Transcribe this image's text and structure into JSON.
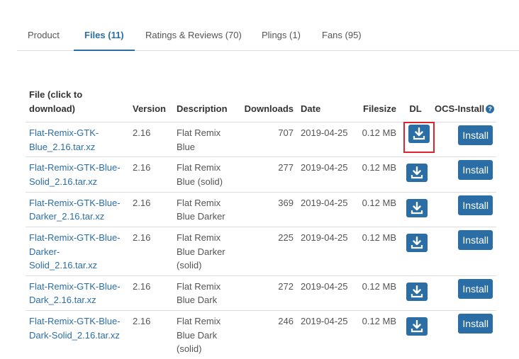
{
  "tabs": [
    {
      "label": "Product"
    },
    {
      "label": "Files (11)",
      "active": true
    },
    {
      "label": "Ratings & Reviews (70)"
    },
    {
      "label": "Plings (1)"
    },
    {
      "label": "Fans (95)"
    }
  ],
  "table": {
    "headers": {
      "file": "File (click to download)",
      "version": "Version",
      "description": "Description",
      "downloads": "Downloads",
      "date": "Date",
      "filesize": "Filesize",
      "dl": "DL",
      "ocs": "OCS-Install",
      "help_icon": "?"
    },
    "install_label": "Install",
    "rows": [
      {
        "file": "Flat-Remix-GTK-Blue_2.16.tar.xz",
        "version": "2.16",
        "description": "Flat Remix Blue",
        "downloads": "707",
        "date": "2019-04-25",
        "filesize": "0.12 MB"
      },
      {
        "file": "Flat-Remix-GTK-Blue-Solid_2.16.tar.xz",
        "version": "2.16",
        "description": "Flat Remix Blue (solid)",
        "downloads": "277",
        "date": "2019-04-25",
        "filesize": "0.12 MB"
      },
      {
        "file": "Flat-Remix-GTK-Blue-Darker_2.16.tar.xz",
        "version": "2.16",
        "description": "Flat Remix Blue Darker",
        "downloads": "369",
        "date": "2019-04-25",
        "filesize": "0.12 MB"
      },
      {
        "file": "Flat-Remix-GTK-Blue-Darker-Solid_2.16.tar.xz",
        "version": "2.16",
        "description": "Flat Remix Blue Darker (solid)",
        "downloads": "225",
        "date": "2019-04-25",
        "filesize": "0.12 MB"
      },
      {
        "file": "Flat-Remix-GTK-Blue-Dark_2.16.tar.xz",
        "version": "2.16",
        "description": "Flat Remix Blue Dark",
        "downloads": "272",
        "date": "2019-04-25",
        "filesize": "0.12 MB"
      },
      {
        "file": "Flat-Remix-GTK-Blue-Dark-Solid_2.16.tar.xz",
        "version": "2.16",
        "description": "Flat Remix Blue Dark (solid)",
        "downloads": "246",
        "date": "2019-04-25",
        "filesize": "0.12 MB"
      }
    ]
  },
  "colors": {
    "accent": "#2b6ea6",
    "highlight": "#e0242f"
  },
  "icons": {
    "download": "download-icon",
    "help": "help-icon"
  }
}
